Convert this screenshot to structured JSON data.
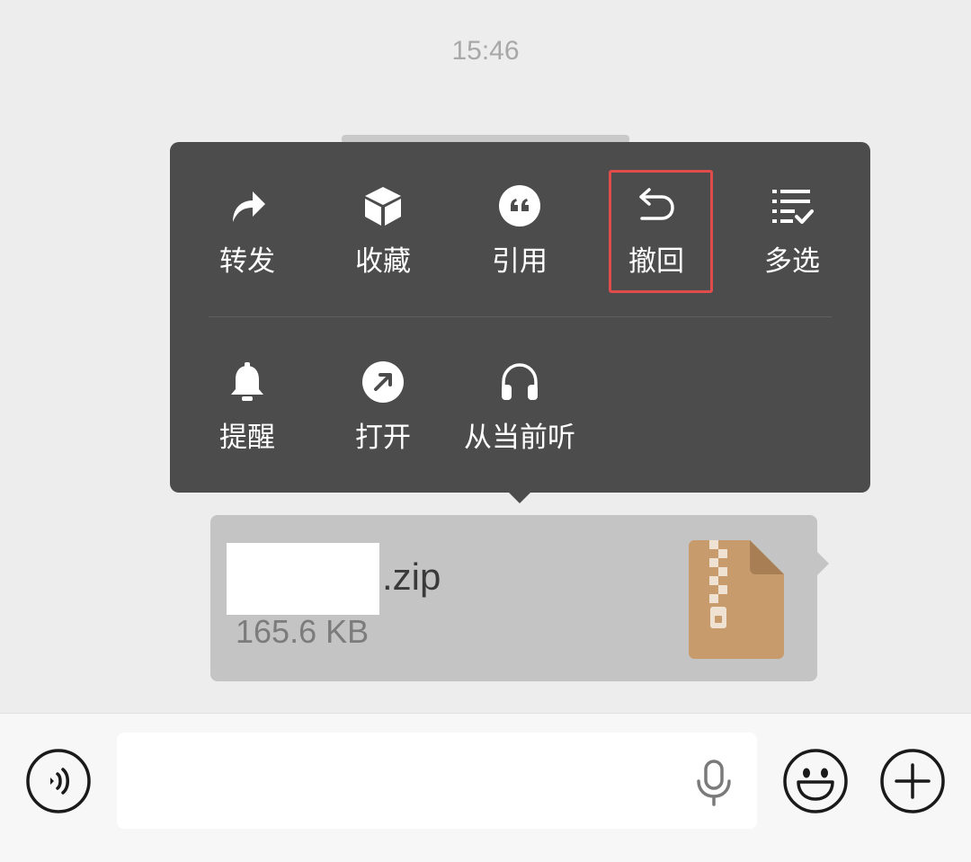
{
  "chat": {
    "timestamp": "15:46"
  },
  "context_menu": {
    "row1": [
      {
        "label": "转发",
        "icon": "forward-icon"
      },
      {
        "label": "收藏",
        "icon": "favorite-cube-icon"
      },
      {
        "label": "引用",
        "icon": "quote-icon"
      },
      {
        "label": "撤回",
        "icon": "recall-icon"
      },
      {
        "label": "多选",
        "icon": "multi-select-icon"
      }
    ],
    "row2": [
      {
        "label": "提醒",
        "icon": "bell-icon"
      },
      {
        "label": "打开",
        "icon": "open-arrow-icon"
      },
      {
        "label": "从当前听",
        "icon": "headphones-icon"
      }
    ],
    "highlighted_item": "撤回"
  },
  "file_message": {
    "extension": ".zip",
    "size": "165.6 KB",
    "icon": "zip-file-icon",
    "icon_color": "#c89b6d"
  },
  "input_bar": {
    "placeholder": "",
    "voice_icon": "voice-toggle-icon",
    "mic_icon": "microphone-icon",
    "emoji_icon": "emoji-icon",
    "plus_icon": "plus-icon"
  },
  "colors": {
    "menu_bg": "#4c4c4c",
    "highlight_border": "#e04b4b",
    "bubble_bg": "#c4c4c4",
    "page_bg": "#ededed"
  }
}
